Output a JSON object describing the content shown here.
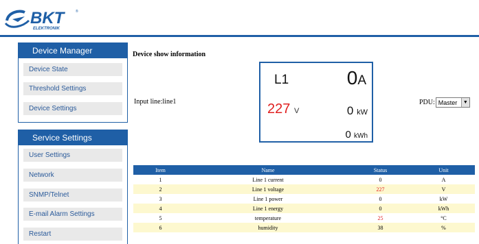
{
  "brand": {
    "logo_text": "BKT",
    "logo_subtext": "ELEKTRONIK"
  },
  "sidebar": {
    "device_manager": {
      "title": "Device Manager",
      "items": [
        {
          "label": "Device State"
        },
        {
          "label": "Threshold Settings"
        },
        {
          "label": "Device Settings"
        }
      ]
    },
    "service_settings": {
      "title": "Service Settings",
      "items": [
        {
          "label": "User Settings"
        },
        {
          "label": "Network"
        },
        {
          "label": "SNMP/Telnet"
        },
        {
          "label": "E-mail Alarm Settings"
        },
        {
          "label": "Restart"
        }
      ]
    }
  },
  "main": {
    "title": "Device show information",
    "input_line": "Input line:line1",
    "pdu_label": "PDU:",
    "pdu_selected": "Master"
  },
  "display": {
    "line": "L1",
    "current": "0",
    "current_unit": "A",
    "voltage": "227",
    "voltage_unit": "V",
    "power": "0",
    "power_unit": "kW",
    "energy": "0",
    "energy_unit": "kWh"
  },
  "table": {
    "headers": [
      "Item",
      "Name",
      "Status",
      "Unit"
    ],
    "rows": [
      [
        "1",
        "Line 1 current",
        "0",
        "A"
      ],
      [
        "2",
        "Line 1 voltage",
        "227",
        "V"
      ],
      [
        "3",
        "Line 1 power",
        "0",
        "kW"
      ],
      [
        "4",
        "Line 1 energy",
        "0",
        "kWh"
      ],
      [
        "5",
        "temperature",
        "25",
        "°C"
      ],
      [
        "6",
        "humidity",
        "38",
        "%"
      ]
    ]
  },
  "colors": {
    "accent": "#1f5fa6",
    "alert_red": "#e02020",
    "row_highlight": "#fdf8cf"
  }
}
